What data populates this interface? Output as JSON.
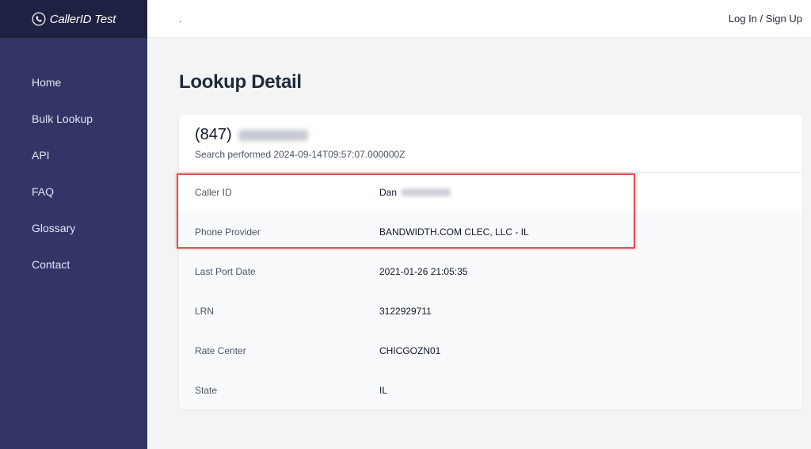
{
  "brand": {
    "name": "CallerID Test"
  },
  "topbar": {
    "dot": ".",
    "login_label": "Log In / Sign Up"
  },
  "sidebar": {
    "items": [
      {
        "label": "Home"
      },
      {
        "label": "Bulk Lookup"
      },
      {
        "label": "API"
      },
      {
        "label": "FAQ"
      },
      {
        "label": "Glossary"
      },
      {
        "label": "Contact"
      }
    ]
  },
  "page": {
    "title": "Lookup Detail"
  },
  "lookup": {
    "phone_area": "(847)",
    "search_text": "Search performed 2024-09-14T09:57:07.000000Z",
    "rows": [
      {
        "label": "Caller ID",
        "value": "Dan"
      },
      {
        "label": "Phone Provider",
        "value": "BANDWIDTH.COM CLEC, LLC - IL"
      },
      {
        "label": "Last Port Date",
        "value": "2021-01-26 21:05:35"
      },
      {
        "label": "LRN",
        "value": "3122929711"
      },
      {
        "label": "Rate Center",
        "value": "CHICGOZN01"
      },
      {
        "label": "State",
        "value": "IL"
      }
    ]
  },
  "colors": {
    "sidebar": "#323566",
    "brand_bar": "#1f2142",
    "highlight": "#e0504e",
    "background": "#f3f4f6"
  }
}
